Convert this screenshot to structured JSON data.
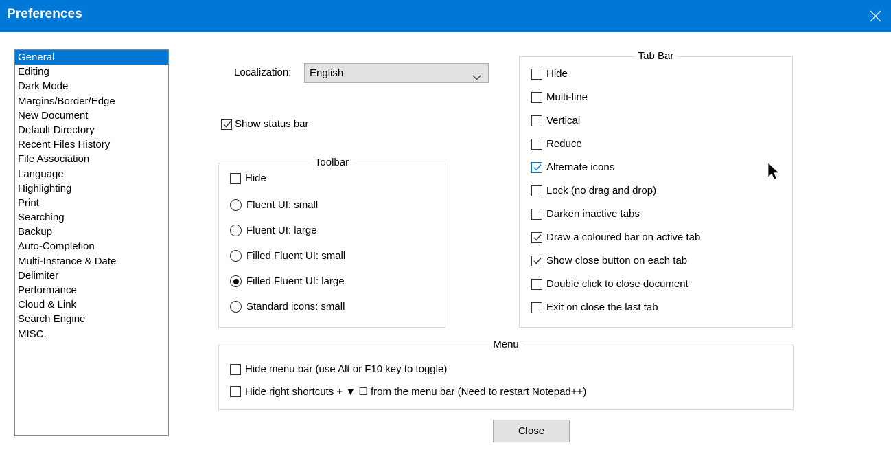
{
  "window": {
    "title": "Preferences",
    "close_icon": "close-x-icon",
    "accent_color": "#0078d7"
  },
  "sidebar": {
    "selected": "General",
    "items": [
      "General",
      "Editing",
      "Dark Mode",
      "Margins/Border/Edge",
      "New Document",
      "Default Directory",
      "Recent Files History",
      "File Association",
      "Language",
      "Highlighting",
      "Print",
      "Searching",
      "Backup",
      "Auto-Completion",
      "Multi-Instance & Date",
      "Delimiter",
      "Performance",
      "Cloud & Link",
      "Search Engine",
      "MISC."
    ]
  },
  "localization": {
    "label": "Localization:",
    "value": "English",
    "arrow_icon": "chevron-down-icon"
  },
  "status_bar": {
    "label": "Show status bar",
    "checked": true
  },
  "toolbar_group": {
    "legend": "Toolbar",
    "hide": {
      "label": "Hide",
      "checked": false
    },
    "options": [
      {
        "label": "Fluent UI: small",
        "selected": false
      },
      {
        "label": "Fluent UI: large",
        "selected": false
      },
      {
        "label": "Filled Fluent UI: small",
        "selected": false
      },
      {
        "label": "Filled Fluent UI: large",
        "selected": true
      },
      {
        "label": "Standard icons: small",
        "selected": false
      }
    ]
  },
  "tabbar_group": {
    "legend": "Tab Bar",
    "items": [
      {
        "label": "Hide",
        "checked": false,
        "hot": false
      },
      {
        "label": "Multi-line",
        "checked": false,
        "hot": false
      },
      {
        "label": "Vertical",
        "checked": false,
        "hot": false
      },
      {
        "label": "Reduce",
        "checked": false,
        "hot": false
      },
      {
        "label": "Alternate icons",
        "checked": true,
        "hot": true
      },
      {
        "label": "Lock (no drag and drop)",
        "checked": false,
        "hot": false
      },
      {
        "label": "Darken inactive tabs",
        "checked": false,
        "hot": false
      },
      {
        "label": "Draw a coloured bar on active tab",
        "checked": true,
        "hot": false
      },
      {
        "label": "Show close button on each tab",
        "checked": true,
        "hot": false
      },
      {
        "label": "Double click to close document",
        "checked": false,
        "hot": false
      },
      {
        "label": "Exit on close the last tab",
        "checked": false,
        "hot": false
      }
    ]
  },
  "menu_group": {
    "legend": "Menu",
    "items": [
      {
        "label": "Hide menu bar (use Alt or F10 key to toggle)",
        "checked": false
      },
      {
        "label": "Hide right shortcuts +  ▼  ☐ from the menu bar (Need to restart Notepad++)",
        "checked": false
      }
    ]
  },
  "footer": {
    "close_label": "Close"
  },
  "cursor": {
    "icon": "arrow-pointer-icon"
  }
}
